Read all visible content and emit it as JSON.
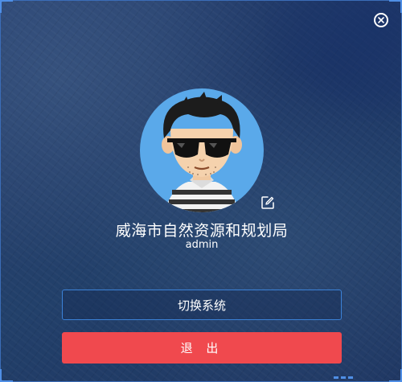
{
  "window": {
    "close_icon": "close-circle-icon"
  },
  "profile": {
    "avatar_icon": "cartoon-avatar-with-sunglasses",
    "edit_icon": "edit-pencil-icon",
    "organization": "威海市自然资源和规划局",
    "username": "admin"
  },
  "actions": {
    "switch_label": "切换系统",
    "logout_label": "退 出"
  },
  "colors": {
    "accent": "#3b82d8",
    "logout": "#f0494e",
    "avatar_bg": "#5aa9ea"
  }
}
